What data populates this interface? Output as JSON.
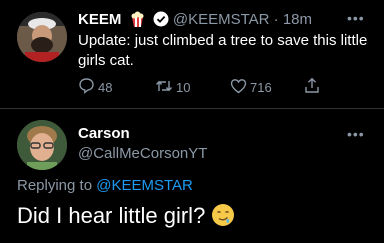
{
  "tweet": {
    "author_name": "KEEM",
    "author_handle": "@KEEMSTAR",
    "time": "· 18m",
    "text": "Update:  just climbed a tree to save this little girls cat.",
    "replies": "48",
    "retweets": "10",
    "likes": "716",
    "icons": [
      "popcorn-icon",
      "verified-badge-icon",
      "reply-icon",
      "retweet-icon",
      "like-icon",
      "share-icon",
      "more-icon"
    ]
  },
  "reply": {
    "author_name": "Carson",
    "author_handle": "@CallMeCorsonYT",
    "replying_prefix": "Replying to",
    "replying_to": "@KEEMSTAR",
    "text": "Did I hear little girl?",
    "emoji_name": "smirk-drool-emoji"
  },
  "colors": {
    "background": "#000000",
    "link": "#1d9bf0",
    "muted": "#8b98a5"
  }
}
